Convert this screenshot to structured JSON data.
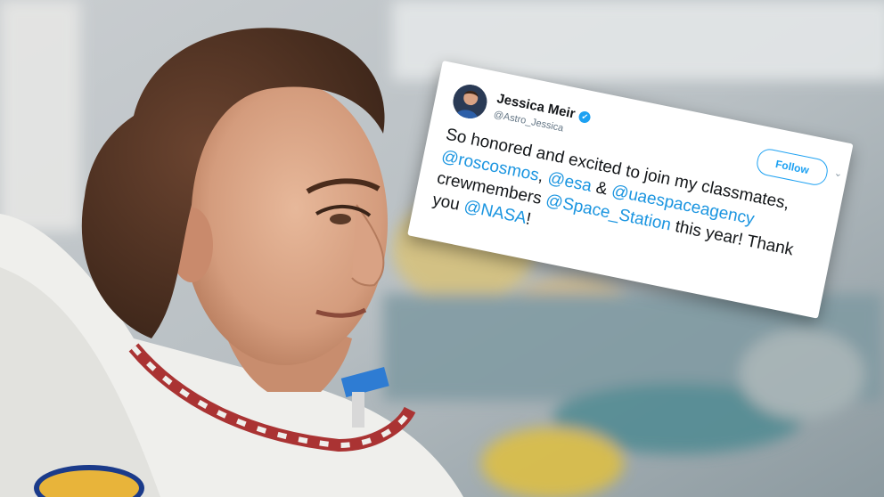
{
  "tweet": {
    "author_name": "Jessica Meir",
    "handle": "@Astro_Jessica",
    "follow_label": "Follow",
    "text_parts": [
      {
        "kind": "text",
        "value": "So honored and excited to join my classmates, "
      },
      {
        "kind": "mention",
        "value": "@roscosmos"
      },
      {
        "kind": "text",
        "value": ", "
      },
      {
        "kind": "mention",
        "value": "@esa"
      },
      {
        "kind": "text",
        "value": " & "
      },
      {
        "kind": "mention",
        "value": "@uaespaceagency"
      },
      {
        "kind": "text",
        "value": " crewmembers "
      },
      {
        "kind": "mention",
        "value": "@Space_Station"
      },
      {
        "kind": "text",
        "value": " this year! Thank you "
      },
      {
        "kind": "mention",
        "value": "@NASA"
      },
      {
        "kind": "text",
        "value": "!"
      }
    ],
    "verified_icon": "verified-badge-icon",
    "more_icon": "chevron-down-icon",
    "accent_color": "#1da1f2"
  }
}
